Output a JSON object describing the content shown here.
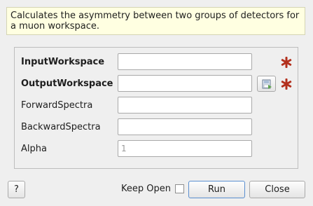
{
  "description": "Calculates the asymmetry between two groups of detectors for a muon workspace.",
  "properties": [
    {
      "label": "InputWorkspace",
      "value": "",
      "placeholder": "",
      "mandatory": true
    },
    {
      "label": "OutputWorkspace",
      "value": "",
      "placeholder": "",
      "mandatory": true
    },
    {
      "label": "ForwardSpectra",
      "value": "",
      "placeholder": "",
      "mandatory": false
    },
    {
      "label": "BackwardSpectra",
      "value": "",
      "placeholder": "",
      "mandatory": false
    },
    {
      "label": "Alpha",
      "value": "",
      "placeholder": "1",
      "mandatory": false
    }
  ],
  "buttons": {
    "help": "?",
    "keep_open": "Keep Open",
    "run": "Run",
    "close": "Close"
  },
  "keep_open_checked": false,
  "icons": {
    "mandatory": "star-icon",
    "browse": "save-workspace-icon"
  },
  "colors": {
    "mandatory_star": "#b3301d",
    "description_bg": "#ffffe1",
    "focus_border": "#5a8fd0"
  }
}
